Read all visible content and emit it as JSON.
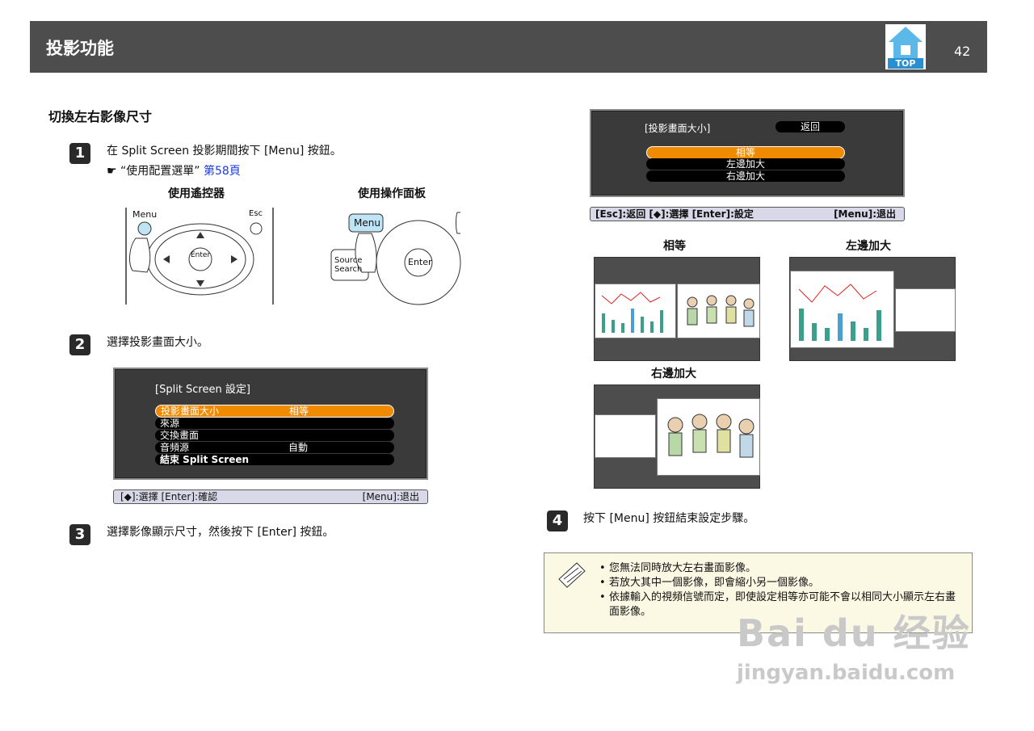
{
  "header": {
    "title": "投影功能",
    "page_number": "42",
    "top_label": "TOP"
  },
  "section_title": "切換左右影像尺寸",
  "steps": [
    {
      "num": "1",
      "text": "在 Split Screen 投影期間按下 [Menu] 按鈕。"
    },
    {
      "num": "2",
      "text": "選擇投影畫面大小。"
    },
    {
      "num": "3",
      "text": "選擇影像顯示尺寸，然後按下 [Enter] 按鈕。"
    },
    {
      "num": "4",
      "text": "按下 [Menu] 按鈕結束設定步驟。"
    }
  ],
  "ref": {
    "pointer": "☛",
    "text": "“使用配置選單”",
    "link": "第58頁"
  },
  "captions": {
    "remote": "使用遙控器",
    "panel": "使用操作面板"
  },
  "remote": {
    "menu": "Menu",
    "esc": "Esc",
    "enter": "Enter"
  },
  "panel": {
    "menu": "Menu",
    "source": "Source Search",
    "enter": "Enter"
  },
  "osd1": {
    "title": "[Split Screen 設定]",
    "rows": [
      {
        "label": "投影畫面大小",
        "value": "相等"
      },
      {
        "label": "來源",
        "value": ""
      },
      {
        "label": "交換畫面",
        "value": ""
      },
      {
        "label": "音頻源",
        "value": "自動"
      },
      {
        "label": "結束 Split Screen",
        "value": ""
      }
    ],
    "help_left": "[◆]:選擇 [Enter]:確認",
    "help_right": "[Menu]:退出"
  },
  "osd2": {
    "title": "[投影畫面大小]",
    "back": "返回",
    "options": [
      "相等",
      "左邊加大",
      "右邊加大"
    ],
    "help_left": "[Esc]:返回 [◆]:選擇 [Enter]:設定",
    "help_right": "[Menu]:退出"
  },
  "layouts": {
    "equal": "相等",
    "left": "左邊加大",
    "right": "右邊加大"
  },
  "notes": [
    "您無法同時放大左右畫面影像。",
    "若放大其中一個影像，即會縮小另一個影像。",
    "依據輸入的視頻信號而定，即使設定相等亦可能不會以相同大小顯示左右畫面影像。"
  ],
  "watermark": {
    "line1": "Bai du 经验",
    "line2": "jingyan.baidu.com"
  },
  "colors": {
    "header_bg": "#4d4d4d",
    "highlight": "#f08a00",
    "link": "#1a3bd6",
    "note_bg": "#fbf8e3"
  }
}
